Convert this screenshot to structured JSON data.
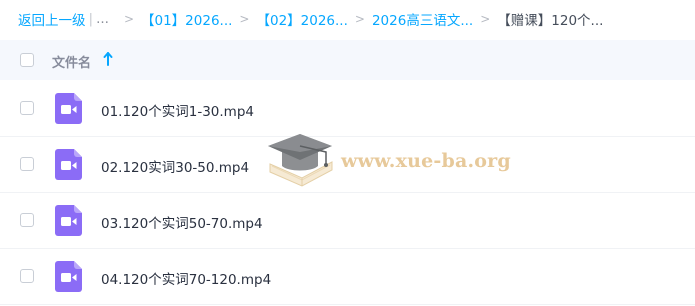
{
  "breadcrumb": {
    "back_label": "返回上一级",
    "separator_bar": "|",
    "ellipsis": "...",
    "arrow": ">",
    "items": [
      {
        "label": "【01】2026..."
      },
      {
        "label": "【02】2026..."
      },
      {
        "label": "2026高三语文..."
      }
    ],
    "current": "【赠课】120个..."
  },
  "header": {
    "file_name_label": "文件名",
    "sort_direction": "ascending",
    "sort_icon": "arrow-up-icon"
  },
  "files": [
    {
      "name": "01.120个实词1-30.mp4",
      "icon": "video-file-icon"
    },
    {
      "name": "02.120实词30-50.mp4",
      "icon": "video-file-icon"
    },
    {
      "name": "03.120个实词50-70.mp4",
      "icon": "video-file-icon"
    },
    {
      "name": "04.120个实词70-120.mp4",
      "icon": "video-file-icon"
    }
  ],
  "watermark": {
    "text": "www.xue-ba.org",
    "icon": "graduation-cap-book-icon"
  },
  "colors": {
    "accent": "#06a7ff",
    "video_icon": "#8b6cf6",
    "header_bg": "#f5f8fd",
    "watermark": "#e7c99a"
  }
}
